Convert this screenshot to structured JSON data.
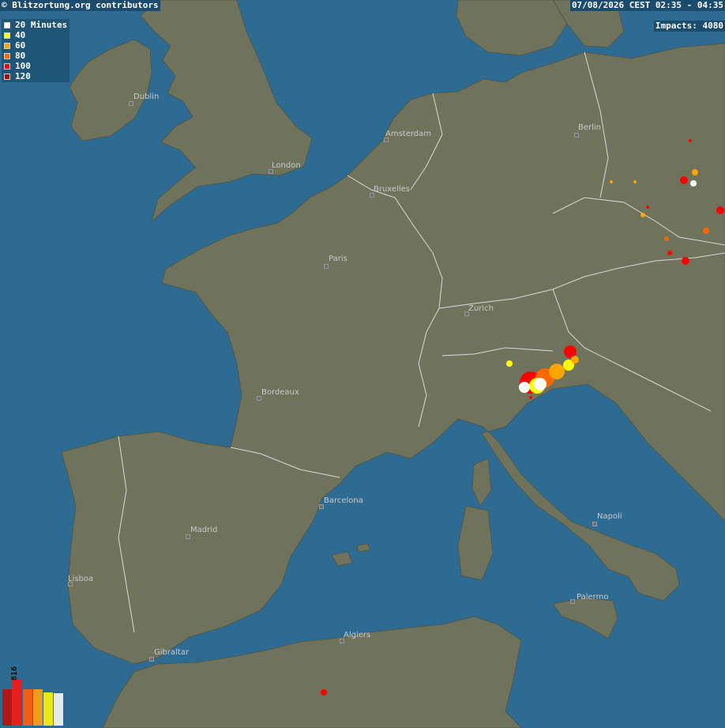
{
  "header": {
    "credit": "© Blitzortung.org contributors",
    "time_range": "07/08/2026 CEST 02:35 - 04:35",
    "impacts": "Impacts: 4080"
  },
  "legend": {
    "items": [
      {
        "label": "20 Minutes",
        "color": "#ffffff"
      },
      {
        "label": "40",
        "color": "#ffff00"
      },
      {
        "label": "60",
        "color": "#ffa500"
      },
      {
        "label": "80",
        "color": "#ff6600"
      },
      {
        "label": "100",
        "color": "#ff0000"
      },
      {
        "label": "120",
        "color": "#b30000"
      }
    ]
  },
  "cities": [
    {
      "name": "Dublin"
    },
    {
      "name": "London"
    },
    {
      "name": "Amsterdam"
    },
    {
      "name": "Berlin"
    },
    {
      "name": "Bruxelles"
    },
    {
      "name": "Paris"
    },
    {
      "name": "Zurich"
    },
    {
      "name": "Bordeaux"
    },
    {
      "name": "Barcelona"
    },
    {
      "name": "Madrid"
    },
    {
      "name": "Lisboa"
    },
    {
      "name": "Napoli"
    },
    {
      "name": "Palermo"
    },
    {
      "name": "Algiers"
    },
    {
      "name": "Gibraltar"
    }
  ],
  "histogram": {
    "label": "816",
    "bars": [
      {
        "value": 0.8,
        "color": "#b01717"
      },
      {
        "value": 1.0,
        "color": "#e61e1e"
      },
      {
        "value": 0.8,
        "color": "#f25c14"
      },
      {
        "value": 0.8,
        "color": "#ee9a1a"
      },
      {
        "value": 0.73,
        "color": "#e9e914"
      },
      {
        "value": 0.7,
        "color": "#e8e8e8"
      }
    ]
  },
  "colors": {
    "sea": "#2e6b92",
    "land": "#6f735c",
    "border": "#d9d9d9"
  }
}
